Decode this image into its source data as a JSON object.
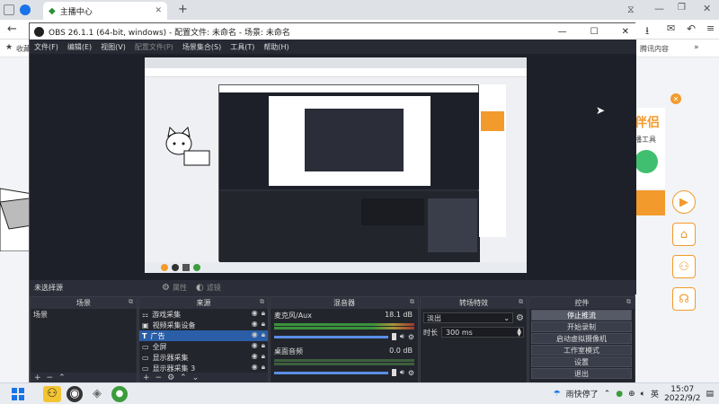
{
  "browser": {
    "tab_label": "主播中心",
    "new_tab": "+",
    "bookmark_left": "收藏",
    "bookmark_right": "腾讯内容"
  },
  "obs": {
    "title": "OBS 26.1.1 (64-bit, windows) - 配置文件: 未命名 - 场景: 未命名",
    "menu": [
      "文件(F)",
      "编辑(E)",
      "视图(V)",
      "配置文件(P)",
      "场景集合(S)",
      "工具(T)",
      "帮助(H)"
    ],
    "no_source_selected": "未选择源",
    "props_label": "属性",
    "filters_label": "滤镜",
    "docks": {
      "scenes": "场景",
      "sources": "来源",
      "mixer": "混音器",
      "transitions": "转场特效",
      "controls": "控件"
    },
    "scenes": [
      "场景"
    ],
    "sources": [
      {
        "name": "游戏采集",
        "icon": "gamepad-icon"
      },
      {
        "name": "视频采集设备",
        "icon": "camera-icon"
      },
      {
        "name": "广告",
        "icon": "text-icon",
        "selected": true
      },
      {
        "name": "全屏",
        "icon": "monitor-icon"
      },
      {
        "name": "显示器采集",
        "icon": "monitor-icon"
      },
      {
        "name": "显示器采集 3",
        "icon": "monitor-icon"
      }
    ],
    "mixer": [
      {
        "name": "麦克风/Aux",
        "db": "18.1 dB"
      },
      {
        "name": "桌面音频",
        "db": "0.0 dB"
      }
    ],
    "transition": {
      "type": "淡出",
      "duration_label": "时长",
      "duration": "300 ms"
    },
    "controls": [
      "停止推流",
      "开始录制",
      "启动虚拟摄像机",
      "工作室模式",
      "设置",
      "退出"
    ]
  },
  "web_sidebar_text": {
    "logo_partial": "伴侣",
    "sub_partial": "播工具"
  },
  "taskbar": {
    "weather": "雨快停了",
    "ime": "英",
    "time": "15:07",
    "date": "2022/9/2"
  },
  "colors": {
    "accent_orange": "#f39a2c",
    "obs_bg": "#2b2e38",
    "selection_blue": "#2a5ea6"
  }
}
